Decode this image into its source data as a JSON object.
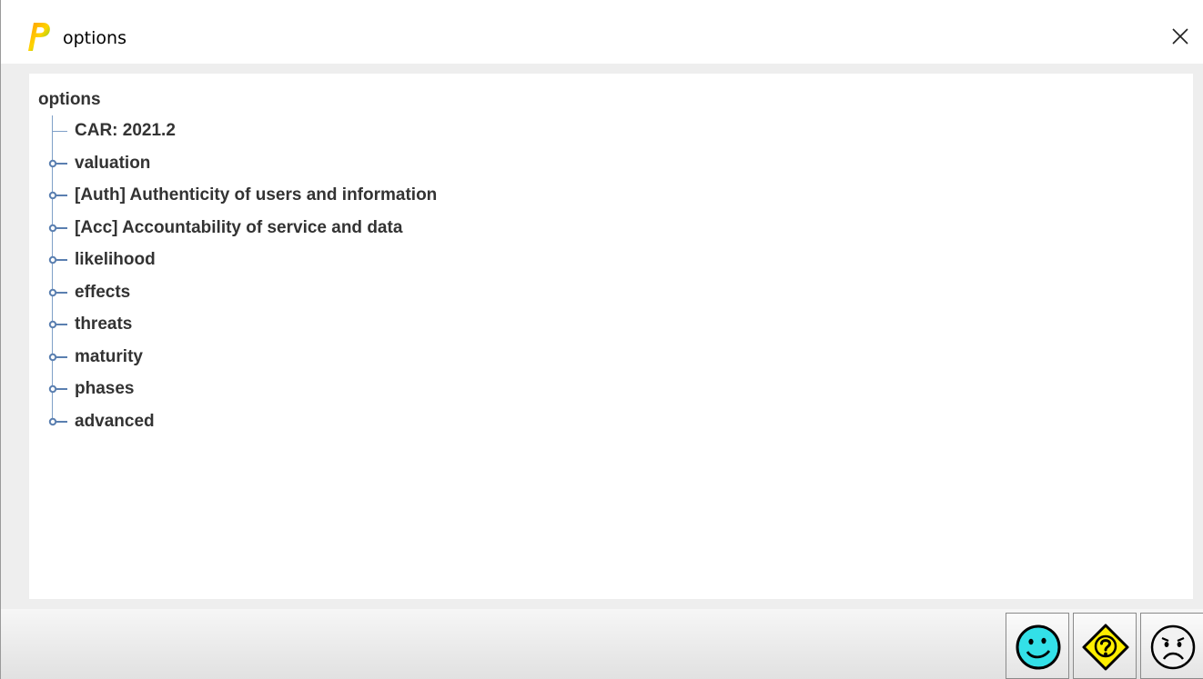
{
  "window": {
    "title": "options",
    "app_icon": "p-letter-icon",
    "close_icon": "close-icon"
  },
  "tree": {
    "root_label": "options",
    "items": [
      {
        "label": "CAR: 2021.2",
        "expandable": false
      },
      {
        "label": "valuation",
        "expandable": true
      },
      {
        "label": "[Auth] Authenticity of users and information",
        "expandable": true
      },
      {
        "label": "[Acc] Accountability of service and data",
        "expandable": true
      },
      {
        "label": "likelihood",
        "expandable": true
      },
      {
        "label": "effects",
        "expandable": true
      },
      {
        "label": "threats",
        "expandable": true
      },
      {
        "label": "maturity",
        "expandable": true
      },
      {
        "label": "phases",
        "expandable": true
      },
      {
        "label": "advanced",
        "expandable": true
      }
    ]
  },
  "buttons": {
    "ok_icon": "smiley-happy-icon",
    "help_icon": "question-diamond-icon",
    "cancel_icon": "smiley-sad-icon"
  },
  "colors": {
    "tree_text": "#333333",
    "tree_line": "#7fa0c8",
    "ok_face": "#33e0e8",
    "help_diamond": "#ffee00"
  }
}
